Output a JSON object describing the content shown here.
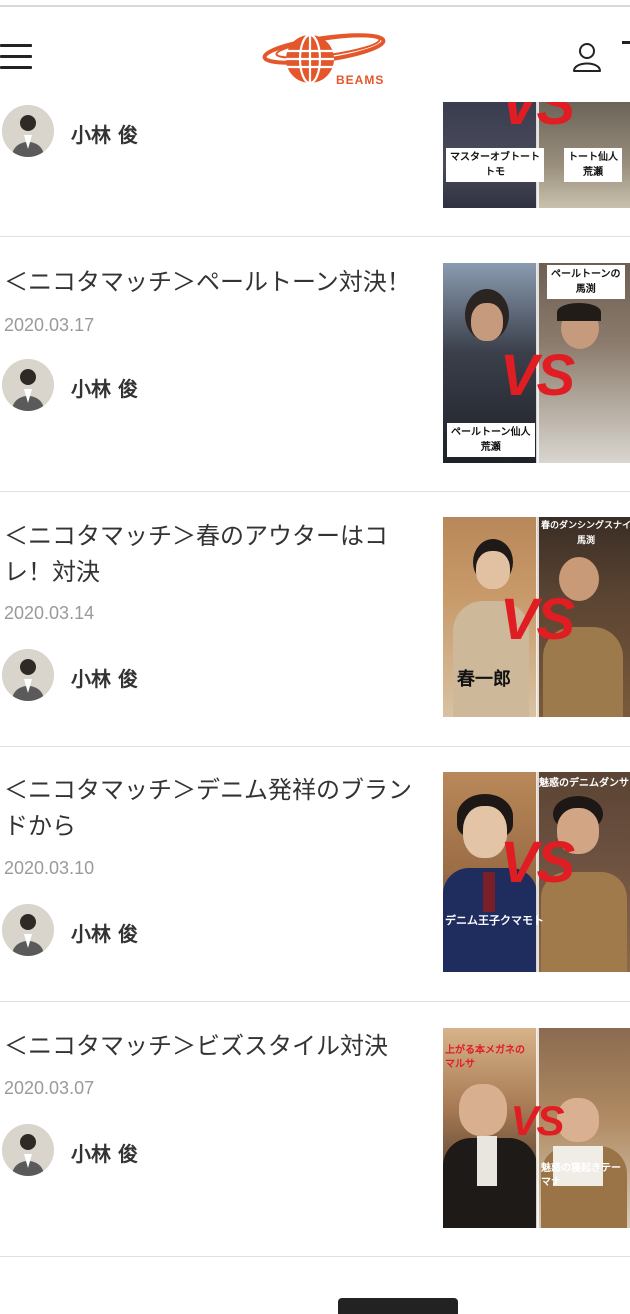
{
  "header": {
    "logo_text": "BEAMS",
    "brand_color": "#e5562b"
  },
  "articles": [
    {
      "author": "小林 俊",
      "thumb": {
        "caption_left": "マスターオブトート\nトモ",
        "caption_right": "トート仙人\n荒瀬",
        "vs": "VS"
      }
    },
    {
      "title": "＜ニコタマッチ＞ペールトーン対決！",
      "date": "2020.03.17",
      "author": "小林 俊",
      "thumb": {
        "caption_left": "ペールトーン仙人\n荒瀬",
        "caption_right": "ペールトーンの\n馬渕",
        "vs": "VS"
      }
    },
    {
      "title": "＜ニコタマッチ＞春のアウターはコレ！対決",
      "date": "2020.03.14",
      "author": "小林 俊",
      "thumb": {
        "caption_left": "春一郎",
        "caption_right": "春のダンシングスナイ\n馬渕",
        "vs": "VS"
      }
    },
    {
      "title": "＜ニコタマッチ＞デニム発祥のブランドから",
      "date": "2020.03.10",
      "author": "小林 俊",
      "thumb": {
        "caption_left": "デニム王子クマモト",
        "caption_right": "魅惑のデニムダンサ",
        "vs": "VS"
      }
    },
    {
      "title": "＜ニコタマッチ＞ビズスタイル対決",
      "date": "2020.03.07",
      "author": "小林 俊",
      "thumb": {
        "caption_left": "上がる本メガネの\nマルサ",
        "caption_right": "魅惑の寝起きテー\nマナ",
        "vs": "VS"
      }
    }
  ]
}
